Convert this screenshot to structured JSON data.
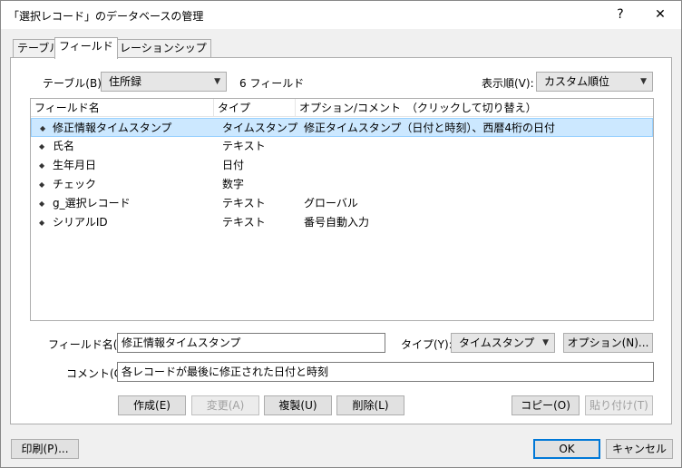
{
  "window": {
    "title": "「選択レコード」のデータベースの管理",
    "help_glyph": "?",
    "close_glyph": "✕"
  },
  "tabs": [
    {
      "label": "テーブル"
    },
    {
      "label": "フィールド"
    },
    {
      "label": "リレーションシップ"
    }
  ],
  "table_selector": {
    "label": "テーブル(B):",
    "value": "住所録",
    "field_count": "6 フィールド"
  },
  "sort_selector": {
    "label": "表示順(V):",
    "value": "カスタム順位"
  },
  "field_list": {
    "columns": [
      "フィールド名",
      "タイプ",
      "オプション/コメント　（クリックして切り替え）"
    ],
    "rows": [
      {
        "name": "修正情報タイムスタンプ",
        "type": "タイムスタンプ",
        "options": "修正タイムスタンプ（日付と時刻）、西暦4桁の日付",
        "selected": true
      },
      {
        "name": "氏名",
        "type": "テキスト",
        "options": ""
      },
      {
        "name": "生年月日",
        "type": "日付",
        "options": ""
      },
      {
        "name": "チェック",
        "type": "数字",
        "options": ""
      },
      {
        "name": "g_選択レコード",
        "type": "テキスト",
        "options": "グローバル"
      },
      {
        "name": "シリアルID",
        "type": "テキスト",
        "options": "番号自動入力"
      }
    ]
  },
  "field_name": {
    "label": "フィールド名(F):",
    "value": "修正情報タイムスタンプ"
  },
  "field_type": {
    "label": "タイプ(Y):",
    "value": "タイムスタンプ"
  },
  "options_button": "オプション(N)...",
  "comment": {
    "label": "コメント(C):",
    "value": "各レコードが最後に修正された日付と時刻"
  },
  "actions": {
    "create": "作成(E)",
    "change": "変更(A)",
    "duplicate": "複製(U)",
    "delete": "削除(L)",
    "copy": "コピー(O)",
    "paste": "貼り付け(T)"
  },
  "footer": {
    "print": "印刷(P)...",
    "ok": "OK",
    "cancel": "キャンセル"
  },
  "icons": {
    "help": "help-icon",
    "close": "close-icon",
    "dropdown": "chevron-down-icon",
    "reorder": "reorder-grip-icon"
  }
}
